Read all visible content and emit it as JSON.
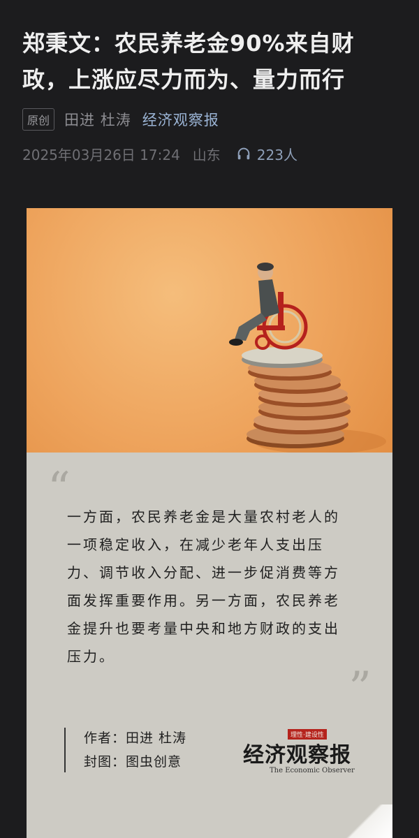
{
  "article": {
    "title": "郑秉文：农民养老金90%来自财政，上涨应尽力而为、量力而行",
    "tag": "原创",
    "authors": "田进 杜涛",
    "source": "经济观察报",
    "datetime": "2025年03月26日 17:24",
    "location": "山东",
    "listen_count": "223人",
    "icons": {
      "listen": "headphones-icon"
    }
  },
  "card": {
    "quote_open": "“",
    "quote_close": "”",
    "quote": "一方面，农民养老金是大量农村老人的一项稳定收入，在减少老年人支出压力、调节收入分配、进一步促消费等方面发挥重要作用。另一方面，农民养老金提升也要考量中央和地方财政的支出压力。",
    "author_line": "作者：田进 杜涛",
    "cover_line": "封图：图虫创意",
    "logo_badge": "理性·建设性",
    "logo_cn": "经济观察报",
    "logo_en": "The Economic Observer"
  },
  "colors": {
    "background": "#1c1c1e",
    "link": "#9ab3d4",
    "photo": "#eea45d",
    "panel": "#cdcbc4"
  }
}
